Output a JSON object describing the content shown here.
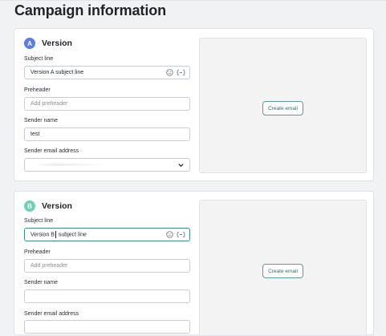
{
  "page": {
    "title": "Campaign information"
  },
  "versions": [
    {
      "badge": "A",
      "label": "Version",
      "subject_label": "Subject line",
      "subject_value": "Version A subject line",
      "preheader_label": "Preheader",
      "preheader_placeholder": "Add preheader",
      "sender_name_label": "Sender name",
      "sender_name_value": "test",
      "sender_email_label": "Sender email address",
      "create_email_label": "Create email"
    },
    {
      "badge": "B",
      "label": "Version",
      "subject_label": "Subject line",
      "subject_value_before": "Version B",
      "subject_value_after": " subject line",
      "preheader_label": "Preheader",
      "preheader_placeholder": "Add preheader",
      "sender_name_label": "Sender name",
      "sender_email_label": "Sender email address",
      "create_email_label": "Create email"
    }
  ],
  "icons": {
    "emoji": "smiley-icon",
    "personalize": "personalization-tag-icon",
    "dropdown": "chevron-down-icon"
  },
  "colors": {
    "badge_a": "#5c7de6",
    "badge_b": "#6fd1b1",
    "accent_teal": "#3f8f8a"
  }
}
